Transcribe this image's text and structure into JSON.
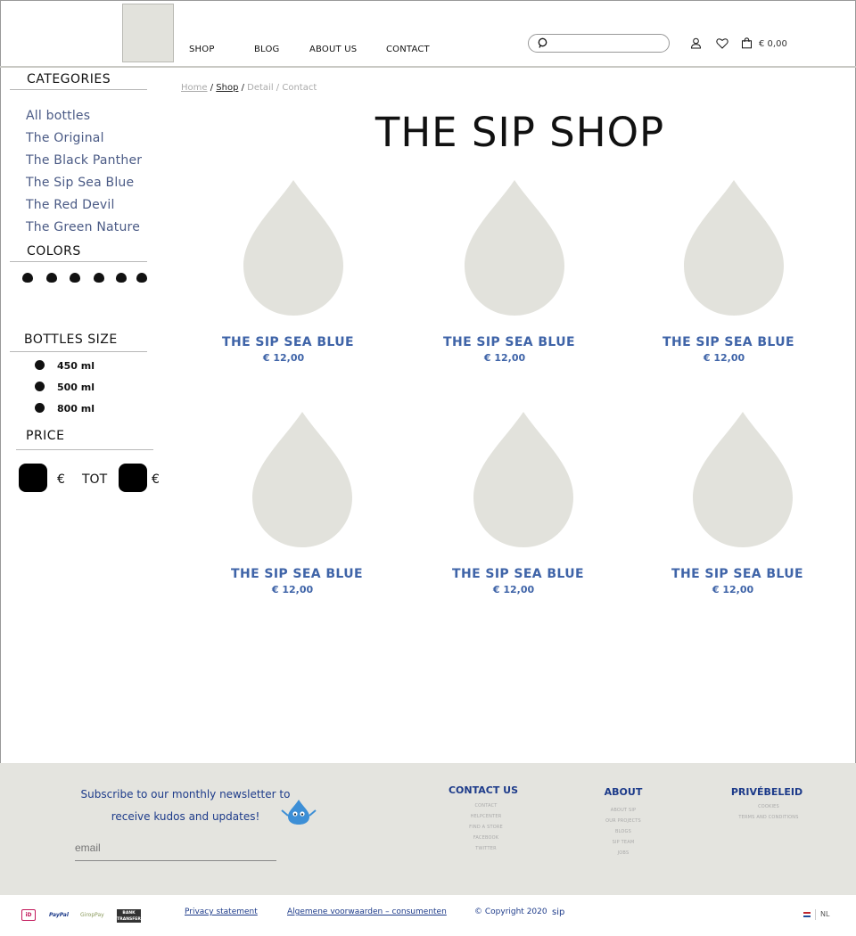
{
  "header": {
    "nav": [
      "SHOP",
      "BLOG",
      "ABOUT US",
      "CONTACT"
    ],
    "search_placeholder": "",
    "cart_total": "€ 0,00",
    "icons": [
      "search-icon",
      "user-icon",
      "heart-icon",
      "cart-icon"
    ]
  },
  "sidebar": {
    "categories_title": "CATEGORIES",
    "categories": [
      "All bottles",
      "The Original",
      "The Black Panther",
      "The Sip Sea Blue",
      "The Red Devil",
      "The Green Nature"
    ],
    "colors_title": "COLORS",
    "color_swatches": [
      "#111111",
      "#111111",
      "#111111",
      "#111111",
      "#111111",
      "#111111"
    ],
    "sizes_title": "BOTTLES SIZE",
    "sizes": [
      "450 ml",
      "500 ml",
      "800 ml"
    ],
    "price_title": "PRICE",
    "price_currency": "€",
    "price_to": "TOT"
  },
  "breadcrumb": {
    "home": "Home",
    "sep": " / ",
    "shop": "Shop",
    "rest": "Detail / Contact"
  },
  "page_title": "THE SIP SHOP",
  "products": [
    {
      "name": "THE SIP SEA BLUE",
      "price": "€ 12,00"
    },
    {
      "name": "THE SIP SEA BLUE",
      "price": "€ 12,00"
    },
    {
      "name": "THE SIP SEA BLUE",
      "price": "€ 12,00"
    },
    {
      "name": "THE SIP SEA BLUE",
      "price": "€ 12,00"
    },
    {
      "name": "THE SIP SEA BLUE",
      "price": "€ 12,00"
    },
    {
      "name": "THE SIP SEA BLUE",
      "price": "€ 12,00"
    }
  ],
  "footer": {
    "newsletter_line1": "Subscribe to our monthly newsletter to",
    "newsletter_line2": "receive kudos and updates!",
    "email_placeholder": "email",
    "contact": {
      "title": "CONTACT US",
      "links": [
        "CONTACT",
        "HELPCENTER",
        "FIND A STORE",
        "FACEBOOK",
        "TWITTER"
      ]
    },
    "about": {
      "title": "ABOUT",
      "links": [
        "ABOUT SIP",
        "OUR PROJECTS",
        "BLOGS",
        "SIP TEAM",
        "JOBS"
      ]
    },
    "privacy": {
      "title": "PRIVÉBELEID",
      "links": [
        "COOKIES",
        "TERMS AND CONDITIONS"
      ]
    }
  },
  "bottom": {
    "payments": [
      "iD",
      "PayPal",
      "GiropPay",
      "BANK TRANSFER"
    ],
    "privacy_statement": "Privacy statement",
    "terms": "Algemene voorwaarden – consumenten",
    "copyright": "© Copyright 2020",
    "brand": "sip",
    "language": "NL"
  },
  "colors": {
    "accent_blue": "#3f64a8",
    "footer_blue": "#1d3b8a",
    "placeholder_grey": "#e2e2dc",
    "footer_bg": "#e4e4df"
  }
}
